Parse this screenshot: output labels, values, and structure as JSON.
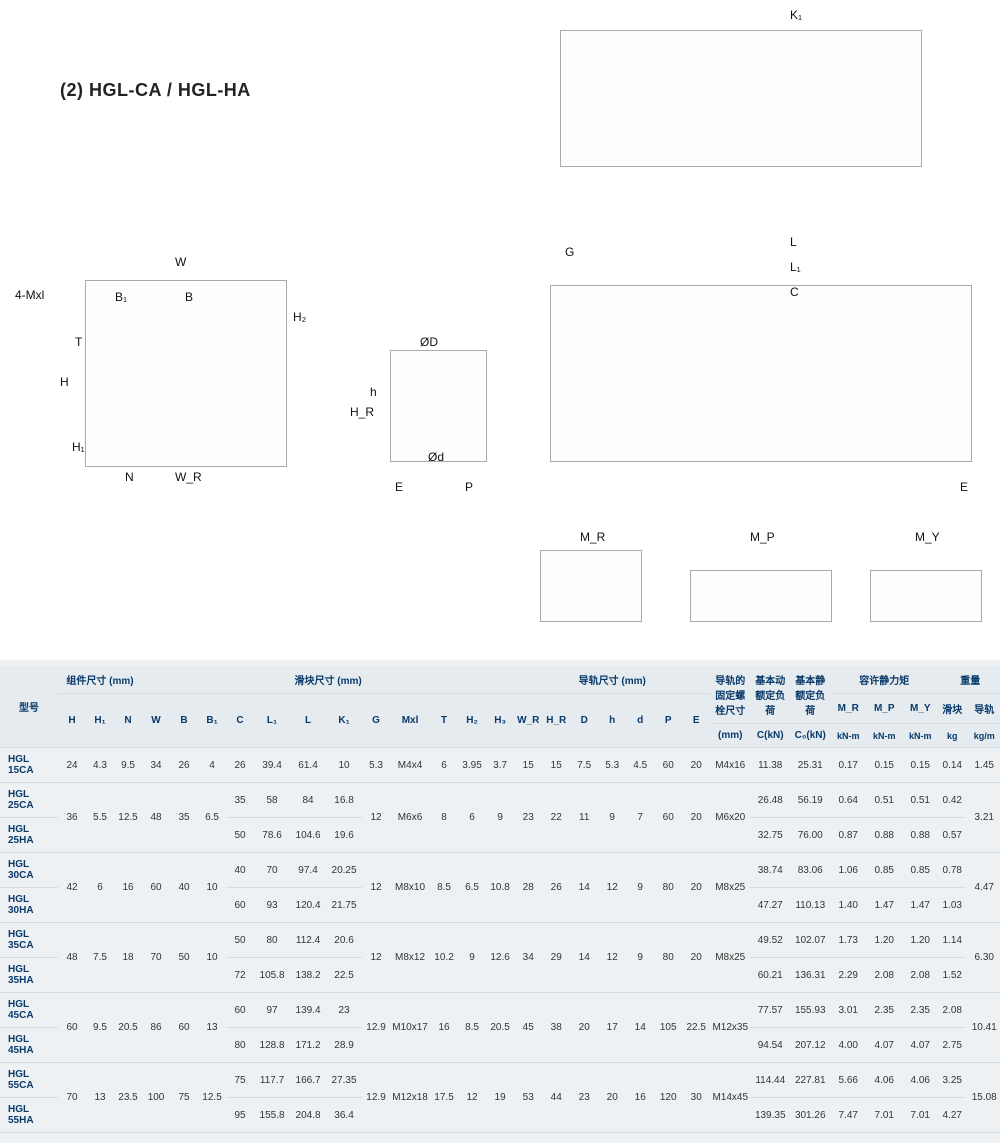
{
  "title": "(2) HGL-CA / HGL-HA",
  "diagram_labels": {
    "top_k1": "K₁",
    "w": "W",
    "mxl": "4-Mxl",
    "b1": "B₁",
    "b": "B",
    "t": "T",
    "h": "H",
    "h1": "H₁",
    "h2": "H₂",
    "n": "N",
    "wr": "W_R",
    "g": "G",
    "l": "L",
    "l1": "L₁",
    "c": "C",
    "od": "ØD",
    "hh": "h",
    "hr": "H_R",
    "od_s": "Ød",
    "e": "E",
    "p": "P",
    "e2": "E",
    "mr": "M_R",
    "mp": "M_P",
    "my": "M_Y"
  },
  "headers": {
    "model": "型号",
    "assembly": "组件尺寸 (mm)",
    "block": "滑块尺寸 (mm)",
    "rail": "导轨尺寸 (mm)",
    "bolt": "导轨的固定螺栓尺寸",
    "dyn": "基本动额定负荷",
    "stat": "基本静额定负荷",
    "moment": "容许静力矩",
    "weight": "重量",
    "cols": {
      "H": "H",
      "H1": "H₁",
      "N": "N",
      "W": "W",
      "B": "B",
      "B1": "B₁",
      "C": "C",
      "L1": "L₁",
      "L": "L",
      "K1": "K₁",
      "G": "G",
      "Mxl": "Mxl",
      "T": "T",
      "H2": "H₂",
      "H3": "H₃",
      "WR": "W_R",
      "HR": "H_R",
      "D": "D",
      "h": "h",
      "d": "d",
      "P": "P",
      "E": "E",
      "bolt": "(mm)",
      "CkN": "C(kN)",
      "C0kN": "C₀(kN)",
      "MR": "M_R",
      "MP": "M_P",
      "MY": "M_Y",
      "MR_u": "kN-m",
      "MP_u": "kN-m",
      "MY_u": "kN-m",
      "wb": "滑块",
      "wr": "导轨",
      "wb_u": "kg",
      "wr_u": "kg/m"
    }
  },
  "rows": [
    {
      "model": "HGL 15CA",
      "H": "24",
      "H1": "4.3",
      "N": "9.5",
      "W": "34",
      "B": "26",
      "B1": "4",
      "C": "26",
      "L1": "39.4",
      "L": "61.4",
      "K1": "10",
      "G": "5.3",
      "Mxl": "M4x4",
      "T": "6",
      "H2": "3.95",
      "H3": "3.7",
      "WR": "15",
      "HR": "15",
      "D": "7.5",
      "h": "5.3",
      "d": "4.5",
      "P": "60",
      "E": "20",
      "bolt": "M4x16",
      "CkN": "11.38",
      "C0kN": "25.31",
      "MR": "0.17",
      "MP": "0.15",
      "MY": "0.15",
      "wb": "0.14",
      "wrw": "1.45"
    },
    {
      "model": "HGL 25CA",
      "H": "36",
      "H1": "5.5",
      "N": "12.5",
      "W": "48",
      "B": "35",
      "B1": "6.5",
      "C": "35",
      "L1": "58",
      "L": "84",
      "K1": "16.8",
      "G": "12",
      "Mxl": "M6x6",
      "T": "8",
      "H2": "6",
      "H3": "9",
      "WR": "23",
      "HR": "22",
      "D": "11",
      "h": "9",
      "d": "7",
      "P": "60",
      "E": "20",
      "bolt": "M6x20",
      "CkN": "26.48",
      "C0kN": "56.19",
      "MR": "0.64",
      "MP": "0.51",
      "MY": "0.51",
      "wb": "0.42",
      "wrw": "3.21"
    },
    {
      "model": "HGL 25HA",
      "H": "",
      "H1": "",
      "N": "",
      "W": "",
      "B": "",
      "B1": "",
      "C": "50",
      "L1": "78.6",
      "L": "104.6",
      "K1": "19.6",
      "G": "",
      "Mxl": "",
      "T": "",
      "H2": "",
      "H3": "",
      "WR": "",
      "HR": "",
      "D": "",
      "h": "",
      "d": "",
      "P": "",
      "E": "",
      "bolt": "",
      "CkN": "32.75",
      "C0kN": "76.00",
      "MR": "0.87",
      "MP": "0.88",
      "MY": "0.88",
      "wb": "0.57",
      "wrw": ""
    },
    {
      "model": "HGL 30CA",
      "H": "42",
      "H1": "6",
      "N": "16",
      "W": "60",
      "B": "40",
      "B1": "10",
      "C": "40",
      "L1": "70",
      "L": "97.4",
      "K1": "20.25",
      "G": "12",
      "Mxl": "M8x10",
      "T": "8.5",
      "H2": "6.5",
      "H3": "10.8",
      "WR": "28",
      "HR": "26",
      "D": "14",
      "h": "12",
      "d": "9",
      "P": "80",
      "E": "20",
      "bolt": "M8x25",
      "CkN": "38.74",
      "C0kN": "83.06",
      "MR": "1.06",
      "MP": "0.85",
      "MY": "0.85",
      "wb": "0.78",
      "wrw": "4.47"
    },
    {
      "model": "HGL 30HA",
      "H": "",
      "H1": "",
      "N": "",
      "W": "",
      "B": "",
      "B1": "",
      "C": "60",
      "L1": "93",
      "L": "120.4",
      "K1": "21.75",
      "G": "",
      "Mxl": "",
      "T": "",
      "H2": "",
      "H3": "",
      "WR": "",
      "HR": "",
      "D": "",
      "h": "",
      "d": "",
      "P": "",
      "E": "",
      "bolt": "",
      "CkN": "47.27",
      "C0kN": "110.13",
      "MR": "1.40",
      "MP": "1.47",
      "MY": "1.47",
      "wb": "1.03",
      "wrw": ""
    },
    {
      "model": "HGL 35CA",
      "H": "48",
      "H1": "7.5",
      "N": "18",
      "W": "70",
      "B": "50",
      "B1": "10",
      "C": "50",
      "L1": "80",
      "L": "112.4",
      "K1": "20.6",
      "G": "12",
      "Mxl": "M8x12",
      "T": "10.2",
      "H2": "9",
      "H3": "12.6",
      "WR": "34",
      "HR": "29",
      "D": "14",
      "h": "12",
      "d": "9",
      "P": "80",
      "E": "20",
      "bolt": "M8x25",
      "CkN": "49.52",
      "C0kN": "102.07",
      "MR": "1.73",
      "MP": "1.20",
      "MY": "1.20",
      "wb": "1.14",
      "wrw": "6.30"
    },
    {
      "model": "HGL 35HA",
      "H": "",
      "H1": "",
      "N": "",
      "W": "",
      "B": "",
      "B1": "",
      "C": "72",
      "L1": "105.8",
      "L": "138.2",
      "K1": "22.5",
      "G": "",
      "Mxl": "",
      "T": "",
      "H2": "",
      "H3": "",
      "WR": "",
      "HR": "",
      "D": "",
      "h": "",
      "d": "",
      "P": "",
      "E": "",
      "bolt": "",
      "CkN": "60.21",
      "C0kN": "136.31",
      "MR": "2.29",
      "MP": "2.08",
      "MY": "2.08",
      "wb": "1.52",
      "wrw": ""
    },
    {
      "model": "HGL 45CA",
      "H": "60",
      "H1": "9.5",
      "N": "20.5",
      "W": "86",
      "B": "60",
      "B1": "13",
      "C": "60",
      "L1": "97",
      "L": "139.4",
      "K1": "23",
      "G": "12.9",
      "Mxl": "M10x17",
      "T": "16",
      "H2": "8.5",
      "H3": "20.5",
      "WR": "45",
      "HR": "38",
      "D": "20",
      "h": "17",
      "d": "14",
      "P": "105",
      "E": "22.5",
      "bolt": "M12x35",
      "CkN": "77.57",
      "C0kN": "155.93",
      "MR": "3.01",
      "MP": "2.35",
      "MY": "2.35",
      "wb": "2.08",
      "wrw": "10.41"
    },
    {
      "model": "HGL 45HA",
      "H": "",
      "H1": "",
      "N": "",
      "W": "",
      "B": "",
      "B1": "",
      "C": "80",
      "L1": "128.8",
      "L": "171.2",
      "K1": "28.9",
      "G": "",
      "Mxl": "",
      "T": "",
      "H2": "",
      "H3": "",
      "WR": "",
      "HR": "",
      "D": "",
      "h": "",
      "d": "",
      "P": "",
      "E": "",
      "bolt": "",
      "CkN": "94.54",
      "C0kN": "207.12",
      "MR": "4.00",
      "MP": "4.07",
      "MY": "4.07",
      "wb": "2.75",
      "wrw": ""
    },
    {
      "model": "HGL 55CA",
      "H": "70",
      "H1": "13",
      "N": "23.5",
      "W": "100",
      "B": "75",
      "B1": "12.5",
      "C": "75",
      "L1": "117.7",
      "L": "166.7",
      "K1": "27.35",
      "G": "12.9",
      "Mxl": "M12x18",
      "T": "17.5",
      "H2": "12",
      "H3": "19",
      "WR": "53",
      "HR": "44",
      "D": "23",
      "h": "20",
      "d": "16",
      "P": "120",
      "E": "30",
      "bolt": "M14x45",
      "CkN": "114.44",
      "C0kN": "227.81",
      "MR": "5.66",
      "MP": "4.06",
      "MY": "4.06",
      "wb": "3.25",
      "wrw": "15.08"
    },
    {
      "model": "HGL 55HA",
      "H": "",
      "H1": "",
      "N": "",
      "W": "",
      "B": "",
      "B1": "",
      "C": "95",
      "L1": "155.8",
      "L": "204.8",
      "K1": "36.4",
      "G": "",
      "Mxl": "",
      "T": "",
      "H2": "",
      "H3": "",
      "WR": "",
      "HR": "",
      "D": "",
      "h": "",
      "d": "",
      "P": "",
      "E": "",
      "bolt": "",
      "CkN": "139.35",
      "C0kN": "301.26",
      "MR": "7.47",
      "MP": "7.01",
      "MY": "7.01",
      "wb": "4.27",
      "wrw": ""
    }
  ]
}
